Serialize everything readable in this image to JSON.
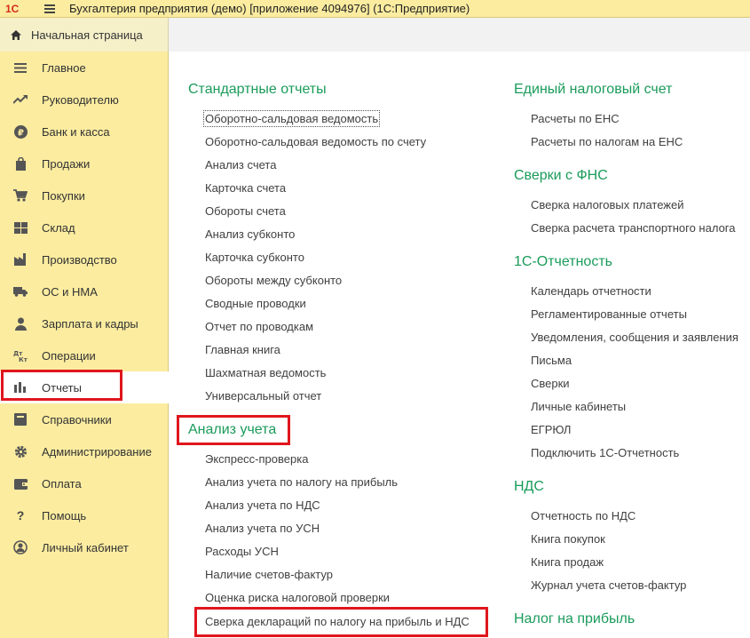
{
  "titlebar": {
    "logo": "1С",
    "title": "Бухгалтерия предприятия (демо) [приложение 4094976]  (1С:Предприятие)"
  },
  "home_tab": {
    "label": "Начальная страница",
    "icon": "home-icon"
  },
  "sidebar": {
    "items": [
      {
        "label": "Главное",
        "icon": "menu-icon"
      },
      {
        "label": "Руководителю",
        "icon": "trend-icon"
      },
      {
        "label": "Банк и касса",
        "icon": "ruble-icon"
      },
      {
        "label": "Продажи",
        "icon": "bag-icon"
      },
      {
        "label": "Покупки",
        "icon": "cart-icon"
      },
      {
        "label": "Склад",
        "icon": "warehouse-icon"
      },
      {
        "label": "Производство",
        "icon": "factory-icon"
      },
      {
        "label": "ОС и НМА",
        "icon": "truck-icon"
      },
      {
        "label": "Зарплата и кадры",
        "icon": "person-icon"
      },
      {
        "label": "Операции",
        "icon": "dt-kt-icon"
      },
      {
        "label": "Отчеты",
        "icon": "bar-chart-icon",
        "active": true
      },
      {
        "label": "Справочники",
        "icon": "book-icon"
      },
      {
        "label": "Администрирование",
        "icon": "gear-icon"
      },
      {
        "label": "Оплата",
        "icon": "wallet-icon"
      },
      {
        "label": "Помощь",
        "icon": "question-icon"
      },
      {
        "label": "Личный кабинет",
        "icon": "user-circle-icon"
      }
    ]
  },
  "left_column": {
    "standard": {
      "title": "Стандартные отчеты",
      "links": [
        "Оборотно-сальдовая ведомость",
        "Оборотно-сальдовая ведомость по счету",
        "Анализ счета",
        "Карточка счета",
        "Обороты счета",
        "Анализ субконто",
        "Карточка субконто",
        "Обороты между субконто",
        "Сводные проводки",
        "Отчет по проводкам",
        "Главная книга",
        "Шахматная ведомость",
        "Универсальный отчет"
      ]
    },
    "analysis": {
      "title": "Анализ учета",
      "links": [
        "Экспресс-проверка",
        "Анализ учета по налогу на прибыль",
        "Анализ учета по НДС",
        "Анализ учета по УСН",
        "Расходы УСН",
        "Наличие счетов-фактур",
        "Оценка риска налоговой проверки",
        "Сверка деклараций по налогу на прибыль и НДС"
      ]
    }
  },
  "right_column": {
    "ens": {
      "title": "Единый налоговый счет",
      "links": [
        "Расчеты по ЕНС",
        "Расчеты по налогам на ЕНС"
      ]
    },
    "fns": {
      "title": "Сверки с ФНС",
      "links": [
        "Сверка налоговых платежей",
        "Сверка расчета транспортного налога"
      ]
    },
    "reporting": {
      "title": "1С-Отчетность",
      "links": [
        "Календарь отчетности",
        "Регламентированные отчеты",
        "Уведомления, сообщения и заявления",
        "Письма",
        "Сверки",
        "Личные кабинеты",
        "ЕГРЮЛ",
        "Подключить 1С-Отчетность"
      ]
    },
    "vat": {
      "title": "НДС",
      "links": [
        "Отчетность по НДС",
        "Книга покупок",
        "Книга продаж",
        "Журнал учета счетов-фактур"
      ]
    },
    "profit": {
      "title": "Налог на прибыль"
    }
  },
  "colors": {
    "sidebar_bg": "#fbeca0",
    "section_title": "#1a9b5a",
    "highlight_box": "#e0161d"
  }
}
